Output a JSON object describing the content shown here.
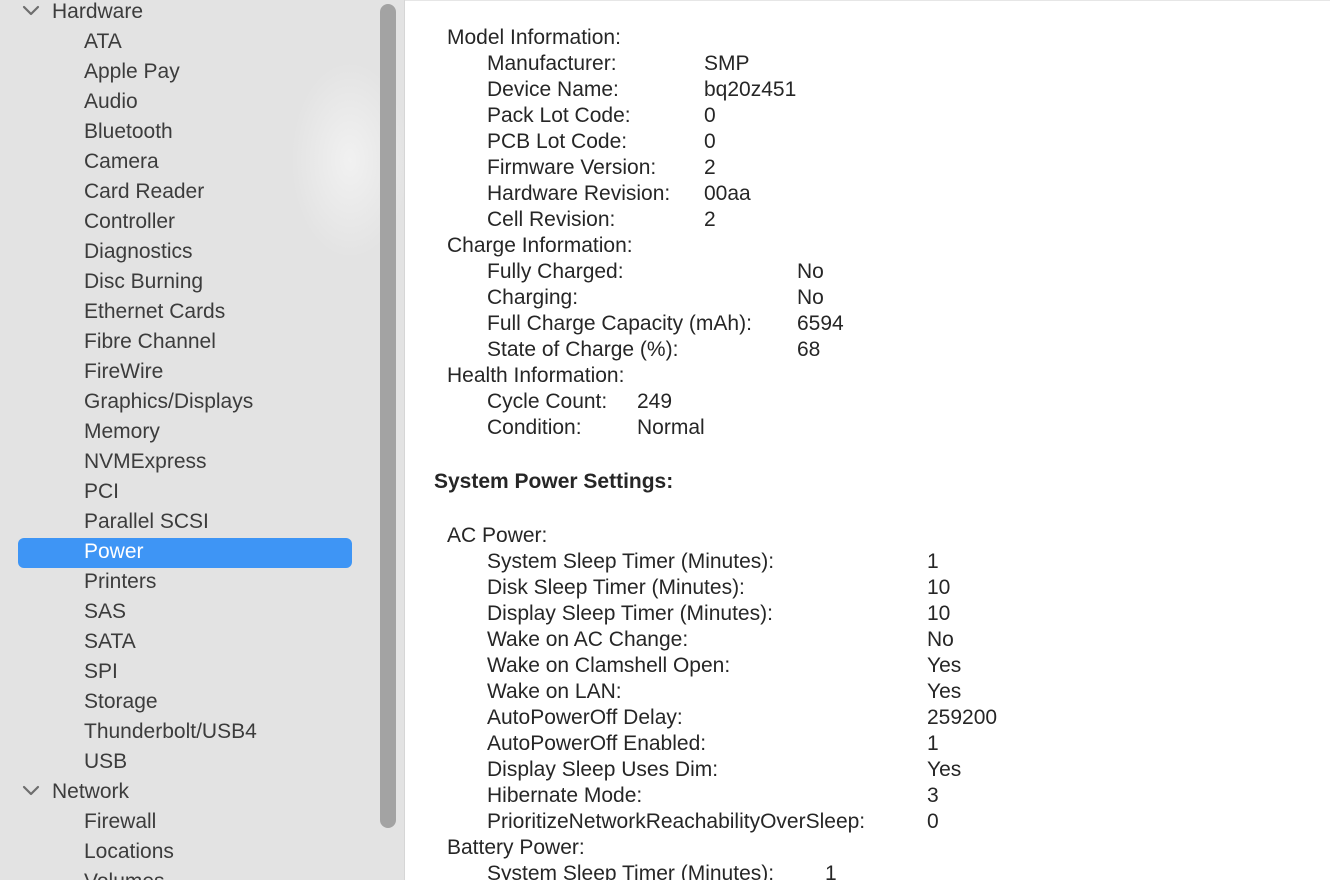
{
  "sidebar": {
    "sections": [
      {
        "label": "Hardware"
      },
      {
        "label": "Network"
      }
    ],
    "hardware_items": [
      "ATA",
      "Apple Pay",
      "Audio",
      "Bluetooth",
      "Camera",
      "Card Reader",
      "Controller",
      "Diagnostics",
      "Disc Burning",
      "Ethernet Cards",
      "Fibre Channel",
      "FireWire",
      "Graphics/Displays",
      "Memory",
      "NVMExpress",
      "PCI",
      "Parallel SCSI",
      "Power",
      "Printers",
      "SAS",
      "SATA",
      "SPI",
      "Storage",
      "Thunderbolt/USB4",
      "USB"
    ],
    "network_items": [
      "Firewall",
      "Locations",
      "Volumes"
    ],
    "selected": "Power"
  },
  "content": {
    "model_info": {
      "heading": "Model Information:",
      "fields": [
        {
          "label": "Manufacturer:",
          "value": "SMP"
        },
        {
          "label": "Device Name:",
          "value": "bq20z451"
        },
        {
          "label": "Pack Lot Code:",
          "value": "0"
        },
        {
          "label": "PCB Lot Code:",
          "value": "0"
        },
        {
          "label": "Firmware Version:",
          "value": "2"
        },
        {
          "label": "Hardware Revision:",
          "value": "00aa"
        },
        {
          "label": "Cell Revision:",
          "value": "2"
        }
      ]
    },
    "charge_info": {
      "heading": "Charge Information:",
      "fields": [
        {
          "label": "Fully Charged:",
          "value": "No"
        },
        {
          "label": "Charging:",
          "value": "No"
        },
        {
          "label": "Full Charge Capacity (mAh):",
          "value": "6594"
        },
        {
          "label": "State of Charge (%):",
          "value": "68"
        }
      ]
    },
    "health_info": {
      "heading": "Health Information:",
      "fields": [
        {
          "label": "Cycle Count:",
          "value": "249"
        },
        {
          "label": "Condition:",
          "value": "Normal"
        }
      ]
    },
    "power_settings_title": "System Power Settings:",
    "ac_power": {
      "heading": "AC Power:",
      "fields": [
        {
          "label": "System Sleep Timer (Minutes):",
          "value": "1"
        },
        {
          "label": "Disk Sleep Timer (Minutes):",
          "value": "10"
        },
        {
          "label": "Display Sleep Timer (Minutes):",
          "value": "10"
        },
        {
          "label": "Wake on AC Change:",
          "value": "No"
        },
        {
          "label": "Wake on Clamshell Open:",
          "value": "Yes"
        },
        {
          "label": "Wake on LAN:",
          "value": "Yes"
        },
        {
          "label": "AutoPowerOff Delay:",
          "value": "259200"
        },
        {
          "label": "AutoPowerOff Enabled:",
          "value": "1"
        },
        {
          "label": "Display Sleep Uses Dim:",
          "value": "Yes"
        },
        {
          "label": "Hibernate Mode:",
          "value": "3"
        },
        {
          "label": "PrioritizeNetworkReachabilityOverSleep:",
          "value": "0"
        }
      ]
    },
    "battery_power": {
      "heading": "Battery Power:",
      "fields": [
        {
          "label": "System Sleep Timer (Minutes):",
          "value": "1"
        }
      ]
    }
  }
}
